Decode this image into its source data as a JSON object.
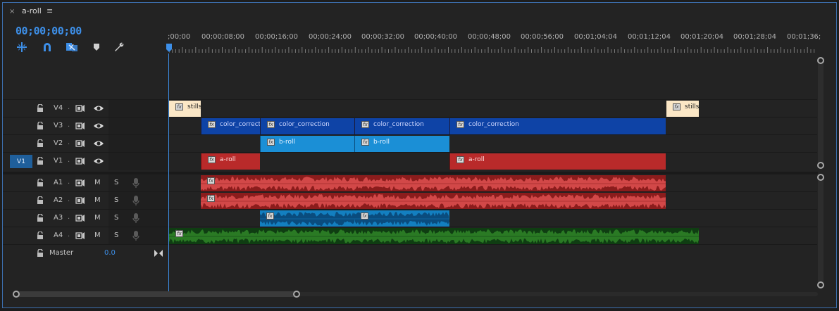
{
  "tab": {
    "close": "×",
    "title": "a-roll",
    "menu": "≡"
  },
  "timecode": "00;00;00;00",
  "tools": [
    "snap-icon",
    "linked-selection-icon",
    "ripple-edit-icon",
    "marker-icon",
    "wrench-icon"
  ],
  "ruler": {
    "labels": [
      ";00;00",
      "00;00;08;00",
      "00;00;16;00",
      "00;00;24;00",
      "00;00;32;00",
      "00;00;40;00",
      "00;00;48;00",
      "00;00;56;00",
      "00;01;04;04",
      "00;01;12;04",
      "00;01;20;04",
      "00;01;28;04",
      "00;01;36;"
    ]
  },
  "video_tracks": [
    {
      "src": "",
      "name": "V4",
      "dot": ".",
      "clips": [
        {
          "type": "stills",
          "label": "stills",
          "start": 0,
          "end": 45
        },
        {
          "type": "stills",
          "label": "stills",
          "start": 706,
          "end": 752
        }
      ]
    },
    {
      "src": "",
      "name": "V3",
      "dot": ".",
      "clips": [
        {
          "type": "color",
          "label": "color_correctio",
          "start": 45,
          "end": 129
        },
        {
          "type": "color",
          "label": "color_correction",
          "start": 129,
          "end": 263
        },
        {
          "type": "color",
          "label": "color_correction",
          "start": 263,
          "end": 398
        },
        {
          "type": "color",
          "label": "color_correction",
          "start": 398,
          "end": 705
        }
      ]
    },
    {
      "src": "",
      "name": "V2",
      "dot": ".",
      "clips": [
        {
          "type": "broll",
          "label": "b-roll",
          "start": 129,
          "end": 263
        },
        {
          "type": "broll",
          "label": "b-roll",
          "start": 263,
          "end": 398
        }
      ]
    },
    {
      "src": "",
      "name": "V1",
      "dot": ".",
      "clips": [
        {
          "type": "aroll",
          "label": "a-roll",
          "start": 45,
          "end": 129
        },
        {
          "type": "aroll",
          "label": "a-roll",
          "start": 398,
          "end": 705
        }
      ]
    }
  ],
  "source_patch": "V1",
  "audio_tracks": [
    {
      "name": "A1",
      "dot": ".",
      "m": "M",
      "s": "S",
      "clips": [
        {
          "color": "red",
          "start": 45,
          "end": 705
        }
      ]
    },
    {
      "name": "A2",
      "dot": ".",
      "m": "M",
      "s": "S",
      "clips": [
        {
          "color": "red",
          "start": 45,
          "end": 705
        }
      ]
    },
    {
      "name": "A3",
      "dot": ".",
      "m": "M",
      "s": "S",
      "clips": [
        {
          "color": "blue",
          "start": 129,
          "end": 263
        },
        {
          "color": "blue",
          "start": 263,
          "end": 398
        }
      ]
    },
    {
      "name": "A4",
      "dot": ".",
      "m": "M",
      "s": "S",
      "clips": [
        {
          "color": "green",
          "start": 0,
          "end": 752
        }
      ]
    }
  ],
  "master": {
    "label": "Master",
    "value": "0.0"
  },
  "colors": {
    "accent": "#3d8fe8",
    "stills": "#fbe7c6",
    "color_correction": "#0e43a6",
    "broll": "#1b8fd6",
    "aroll": "#b92a2a",
    "audio_red": "#8b1c1c",
    "audio_blue": "#137fc0",
    "audio_green": "#0f3d12"
  }
}
